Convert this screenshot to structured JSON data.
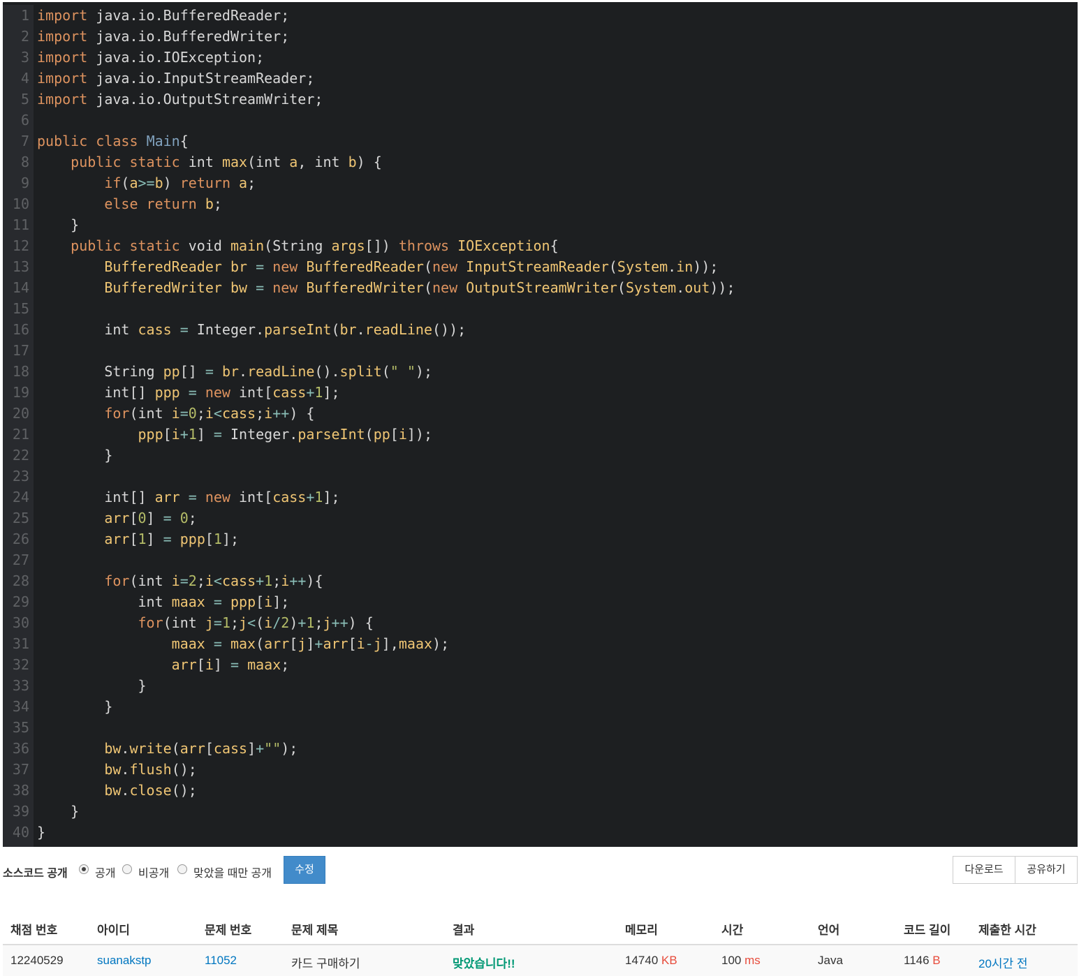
{
  "code_lines": [
    [
      [
        "kw",
        "import"
      ],
      [
        "t",
        " java.io.BufferedReader;"
      ]
    ],
    [
      [
        "kw",
        "import"
      ],
      [
        "t",
        " java.io.BufferedWriter;"
      ]
    ],
    [
      [
        "kw",
        "import"
      ],
      [
        "t",
        " java.io.IOException;"
      ]
    ],
    [
      [
        "kw",
        "import"
      ],
      [
        "t",
        " java.io.InputStreamReader;"
      ]
    ],
    [
      [
        "kw",
        "import"
      ],
      [
        "t",
        " java.io.OutputStreamWriter;"
      ]
    ],
    [],
    [
      [
        "kw",
        "public"
      ],
      [
        "t",
        " "
      ],
      [
        "kw",
        "class"
      ],
      [
        "t",
        " "
      ],
      [
        "cls",
        "Main"
      ],
      [
        "t",
        "{"
      ]
    ],
    [
      [
        "t",
        "    "
      ],
      [
        "kw",
        "public"
      ],
      [
        "t",
        " "
      ],
      [
        "kw",
        "static"
      ],
      [
        "t",
        " "
      ],
      [
        "ty",
        "int"
      ],
      [
        "t",
        " "
      ],
      [
        "fn",
        "max"
      ],
      [
        "t",
        "("
      ],
      [
        "ty",
        "int"
      ],
      [
        "t",
        " "
      ],
      [
        "fn",
        "a"
      ],
      [
        "t",
        ", "
      ],
      [
        "ty",
        "int"
      ],
      [
        "t",
        " "
      ],
      [
        "fn",
        "b"
      ],
      [
        "t",
        ") {"
      ]
    ],
    [
      [
        "t",
        "        "
      ],
      [
        "kw",
        "if"
      ],
      [
        "t",
        "("
      ],
      [
        "fn",
        "a"
      ],
      [
        "op",
        ">="
      ],
      [
        "fn",
        "b"
      ],
      [
        "t",
        ") "
      ],
      [
        "kw",
        "return"
      ],
      [
        "t",
        " "
      ],
      [
        "fn",
        "a"
      ],
      [
        "t",
        ";"
      ]
    ],
    [
      [
        "t",
        "        "
      ],
      [
        "kw",
        "else"
      ],
      [
        "t",
        " "
      ],
      [
        "kw",
        "return"
      ],
      [
        "t",
        " "
      ],
      [
        "fn",
        "b"
      ],
      [
        "t",
        ";"
      ]
    ],
    [
      [
        "t",
        "    }"
      ]
    ],
    [
      [
        "t",
        "    "
      ],
      [
        "kw",
        "public"
      ],
      [
        "t",
        " "
      ],
      [
        "kw",
        "static"
      ],
      [
        "t",
        " "
      ],
      [
        "ty",
        "void"
      ],
      [
        "t",
        " "
      ],
      [
        "fn",
        "main"
      ],
      [
        "t",
        "("
      ],
      [
        "ty",
        "String"
      ],
      [
        "t",
        " "
      ],
      [
        "fn",
        "args"
      ],
      [
        "t",
        "[]) "
      ],
      [
        "kw",
        "throws"
      ],
      [
        "t",
        " "
      ],
      [
        "fn",
        "IOException"
      ],
      [
        "t",
        "{"
      ]
    ],
    [
      [
        "t",
        "        "
      ],
      [
        "fn",
        "BufferedReader"
      ],
      [
        "t",
        " "
      ],
      [
        "fn",
        "br"
      ],
      [
        "t",
        " "
      ],
      [
        "op",
        "="
      ],
      [
        "t",
        " "
      ],
      [
        "kw",
        "new"
      ],
      [
        "t",
        " "
      ],
      [
        "fn",
        "BufferedReader"
      ],
      [
        "t",
        "("
      ],
      [
        "kw",
        "new"
      ],
      [
        "t",
        " "
      ],
      [
        "fn",
        "InputStreamReader"
      ],
      [
        "t",
        "("
      ],
      [
        "fn",
        "System"
      ],
      [
        "t",
        "."
      ],
      [
        "fn",
        "in"
      ],
      [
        "t",
        "));"
      ]
    ],
    [
      [
        "t",
        "        "
      ],
      [
        "fn",
        "BufferedWriter"
      ],
      [
        "t",
        " "
      ],
      [
        "fn",
        "bw"
      ],
      [
        "t",
        " "
      ],
      [
        "op",
        "="
      ],
      [
        "t",
        " "
      ],
      [
        "kw",
        "new"
      ],
      [
        "t",
        " "
      ],
      [
        "fn",
        "BufferedWriter"
      ],
      [
        "t",
        "("
      ],
      [
        "kw",
        "new"
      ],
      [
        "t",
        " "
      ],
      [
        "fn",
        "OutputStreamWriter"
      ],
      [
        "t",
        "("
      ],
      [
        "fn",
        "System"
      ],
      [
        "t",
        "."
      ],
      [
        "fn",
        "out"
      ],
      [
        "t",
        "));"
      ]
    ],
    [],
    [
      [
        "t",
        "        "
      ],
      [
        "ty",
        "int"
      ],
      [
        "t",
        " "
      ],
      [
        "fn",
        "cass"
      ],
      [
        "t",
        " "
      ],
      [
        "op",
        "="
      ],
      [
        "t",
        " Integer."
      ],
      [
        "fn",
        "parseInt"
      ],
      [
        "t",
        "("
      ],
      [
        "fn",
        "br"
      ],
      [
        "t",
        "."
      ],
      [
        "fn",
        "readLine"
      ],
      [
        "t",
        "());"
      ]
    ],
    [],
    [
      [
        "t",
        "        "
      ],
      [
        "ty",
        "String"
      ],
      [
        "t",
        " "
      ],
      [
        "fn",
        "pp"
      ],
      [
        "t",
        "[] "
      ],
      [
        "op",
        "="
      ],
      [
        "t",
        " "
      ],
      [
        "fn",
        "br"
      ],
      [
        "t",
        "."
      ],
      [
        "fn",
        "readLine"
      ],
      [
        "t",
        "()."
      ],
      [
        "fn",
        "split"
      ],
      [
        "t",
        "("
      ],
      [
        "str",
        "\" \""
      ],
      [
        "t",
        ");"
      ]
    ],
    [
      [
        "t",
        "        "
      ],
      [
        "ty",
        "int"
      ],
      [
        "t",
        "[] "
      ],
      [
        "fn",
        "ppp"
      ],
      [
        "t",
        " "
      ],
      [
        "op",
        "="
      ],
      [
        "t",
        " "
      ],
      [
        "kw",
        "new"
      ],
      [
        "t",
        " "
      ],
      [
        "ty",
        "int"
      ],
      [
        "t",
        "["
      ],
      [
        "fn",
        "cass"
      ],
      [
        "op",
        "+"
      ],
      [
        "num",
        "1"
      ],
      [
        "t",
        "];"
      ]
    ],
    [
      [
        "t",
        "        "
      ],
      [
        "kw",
        "for"
      ],
      [
        "t",
        "("
      ],
      [
        "ty",
        "int"
      ],
      [
        "t",
        " "
      ],
      [
        "fn",
        "i"
      ],
      [
        "op",
        "="
      ],
      [
        "num",
        "0"
      ],
      [
        "t",
        ";"
      ],
      [
        "fn",
        "i"
      ],
      [
        "op",
        "<"
      ],
      [
        "fn",
        "cass"
      ],
      [
        "t",
        ";"
      ],
      [
        "fn",
        "i"
      ],
      [
        "op",
        "++"
      ],
      [
        "t",
        ") {"
      ]
    ],
    [
      [
        "t",
        "            "
      ],
      [
        "fn",
        "ppp"
      ],
      [
        "t",
        "["
      ],
      [
        "fn",
        "i"
      ],
      [
        "op",
        "+"
      ],
      [
        "num",
        "1"
      ],
      [
        "t",
        "] "
      ],
      [
        "op",
        "="
      ],
      [
        "t",
        " Integer."
      ],
      [
        "fn",
        "parseInt"
      ],
      [
        "t",
        "("
      ],
      [
        "fn",
        "pp"
      ],
      [
        "t",
        "["
      ],
      [
        "fn",
        "i"
      ],
      [
        "t",
        "]);"
      ]
    ],
    [
      [
        "t",
        "        }"
      ]
    ],
    [],
    [
      [
        "t",
        "        "
      ],
      [
        "ty",
        "int"
      ],
      [
        "t",
        "[] "
      ],
      [
        "fn",
        "arr"
      ],
      [
        "t",
        " "
      ],
      [
        "op",
        "="
      ],
      [
        "t",
        " "
      ],
      [
        "kw",
        "new"
      ],
      [
        "t",
        " "
      ],
      [
        "ty",
        "int"
      ],
      [
        "t",
        "["
      ],
      [
        "fn",
        "cass"
      ],
      [
        "op",
        "+"
      ],
      [
        "num",
        "1"
      ],
      [
        "t",
        "];"
      ]
    ],
    [
      [
        "t",
        "        "
      ],
      [
        "fn",
        "arr"
      ],
      [
        "t",
        "["
      ],
      [
        "num",
        "0"
      ],
      [
        "t",
        "] "
      ],
      [
        "op",
        "="
      ],
      [
        "t",
        " "
      ],
      [
        "num",
        "0"
      ],
      [
        "t",
        ";"
      ]
    ],
    [
      [
        "t",
        "        "
      ],
      [
        "fn",
        "arr"
      ],
      [
        "t",
        "["
      ],
      [
        "num",
        "1"
      ],
      [
        "t",
        "] "
      ],
      [
        "op",
        "="
      ],
      [
        "t",
        " "
      ],
      [
        "fn",
        "ppp"
      ],
      [
        "t",
        "["
      ],
      [
        "num",
        "1"
      ],
      [
        "t",
        "];"
      ]
    ],
    [],
    [
      [
        "t",
        "        "
      ],
      [
        "kw",
        "for"
      ],
      [
        "t",
        "("
      ],
      [
        "ty",
        "int"
      ],
      [
        "t",
        " "
      ],
      [
        "fn",
        "i"
      ],
      [
        "op",
        "="
      ],
      [
        "num",
        "2"
      ],
      [
        "t",
        ";"
      ],
      [
        "fn",
        "i"
      ],
      [
        "op",
        "<"
      ],
      [
        "fn",
        "cass"
      ],
      [
        "op",
        "+"
      ],
      [
        "num",
        "1"
      ],
      [
        "t",
        ";"
      ],
      [
        "fn",
        "i"
      ],
      [
        "op",
        "++"
      ],
      [
        "t",
        "){"
      ]
    ],
    [
      [
        "t",
        "            "
      ],
      [
        "ty",
        "int"
      ],
      [
        "t",
        " "
      ],
      [
        "fn",
        "maax"
      ],
      [
        "t",
        " "
      ],
      [
        "op",
        "="
      ],
      [
        "t",
        " "
      ],
      [
        "fn",
        "ppp"
      ],
      [
        "t",
        "["
      ],
      [
        "fn",
        "i"
      ],
      [
        "t",
        "];"
      ]
    ],
    [
      [
        "t",
        "            "
      ],
      [
        "kw",
        "for"
      ],
      [
        "t",
        "("
      ],
      [
        "ty",
        "int"
      ],
      [
        "t",
        " "
      ],
      [
        "fn",
        "j"
      ],
      [
        "op",
        "="
      ],
      [
        "num",
        "1"
      ],
      [
        "t",
        ";"
      ],
      [
        "fn",
        "j"
      ],
      [
        "op",
        "<"
      ],
      [
        "t",
        "("
      ],
      [
        "fn",
        "i"
      ],
      [
        "op",
        "/"
      ],
      [
        "num",
        "2"
      ],
      [
        "t",
        ")"
      ],
      [
        "op",
        "+"
      ],
      [
        "num",
        "1"
      ],
      [
        "t",
        ";"
      ],
      [
        "fn",
        "j"
      ],
      [
        "op",
        "++"
      ],
      [
        "t",
        ") {"
      ]
    ],
    [
      [
        "t",
        "                "
      ],
      [
        "fn",
        "maax"
      ],
      [
        "t",
        " "
      ],
      [
        "op",
        "="
      ],
      [
        "t",
        " "
      ],
      [
        "fn",
        "max"
      ],
      [
        "t",
        "("
      ],
      [
        "fn",
        "arr"
      ],
      [
        "t",
        "["
      ],
      [
        "fn",
        "j"
      ],
      [
        "t",
        "]"
      ],
      [
        "op",
        "+"
      ],
      [
        "fn",
        "arr"
      ],
      [
        "t",
        "["
      ],
      [
        "fn",
        "i"
      ],
      [
        "op",
        "-"
      ],
      [
        "fn",
        "j"
      ],
      [
        "t",
        "],"
      ],
      [
        "fn",
        "maax"
      ],
      [
        "t",
        ");"
      ]
    ],
    [
      [
        "t",
        "                "
      ],
      [
        "fn",
        "arr"
      ],
      [
        "t",
        "["
      ],
      [
        "fn",
        "i"
      ],
      [
        "t",
        "] "
      ],
      [
        "op",
        "="
      ],
      [
        "t",
        " "
      ],
      [
        "fn",
        "maax"
      ],
      [
        "t",
        ";"
      ]
    ],
    [
      [
        "t",
        "            }"
      ]
    ],
    [
      [
        "t",
        "        }"
      ]
    ],
    [],
    [
      [
        "t",
        "        "
      ],
      [
        "fn",
        "bw"
      ],
      [
        "t",
        "."
      ],
      [
        "fn",
        "write"
      ],
      [
        "t",
        "("
      ],
      [
        "fn",
        "arr"
      ],
      [
        "t",
        "["
      ],
      [
        "fn",
        "cass"
      ],
      [
        "t",
        "]"
      ],
      [
        "op",
        "+"
      ],
      [
        "str",
        "\"\""
      ],
      [
        "t",
        ");"
      ]
    ],
    [
      [
        "t",
        "        "
      ],
      [
        "fn",
        "bw"
      ],
      [
        "t",
        "."
      ],
      [
        "fn",
        "flush"
      ],
      [
        "t",
        "();"
      ]
    ],
    [
      [
        "t",
        "        "
      ],
      [
        "fn",
        "bw"
      ],
      [
        "t",
        "."
      ],
      [
        "fn",
        "close"
      ],
      [
        "t",
        "();"
      ]
    ],
    [
      [
        "t",
        "    }"
      ]
    ],
    [
      [
        "t",
        "}"
      ]
    ]
  ],
  "controls": {
    "source_label": "소스코드 공개",
    "options": [
      "공개",
      "비공개",
      "맞았을 때만 공개"
    ],
    "selected_index": 0,
    "edit_button": "수정",
    "download_button": "다운로드",
    "share_button": "공유하기"
  },
  "table": {
    "headers": [
      "채점 번호",
      "아이디",
      "문제 번호",
      "문제 제목",
      "결과",
      "메모리",
      "시간",
      "언어",
      "코드 길이",
      "제출한 시간"
    ],
    "row": {
      "submission_id": "12240529",
      "user_id": "suanakstp",
      "problem_id": "11052",
      "problem_title": "카드 구매하기",
      "result": "맞았습니다!!",
      "memory": "14740",
      "memory_unit": "KB",
      "time": "100",
      "time_unit": "ms",
      "language": "Java",
      "code_length": "1146",
      "code_length_unit": "B",
      "submitted_at": "20시간 전"
    }
  }
}
